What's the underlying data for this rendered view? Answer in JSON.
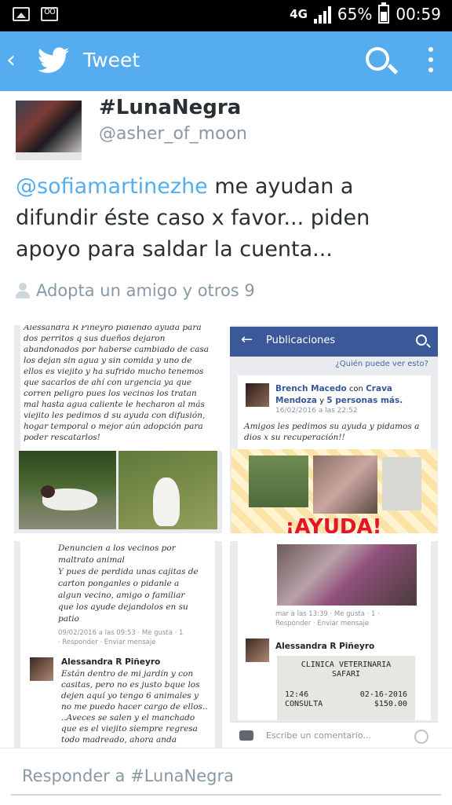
{
  "status_bar": {
    "network": "4G",
    "battery": "65%",
    "time": "00:59",
    "battery_level": 0.65
  },
  "app_bar": {
    "title": "Tweet",
    "back_icon": "chevron-left-icon",
    "logo_icon": "twitter-bird-icon",
    "search_icon": "search-icon",
    "overflow_icon": "more-vert-icon"
  },
  "tweet": {
    "display_name": "#LunaNegra",
    "handle": "@asher_of_moon",
    "mention": "@sofiamartinezhe",
    "text": " me ayudan a difundir éste caso x favor... piden apoyo para saldar la cuenta...",
    "social_context": "Adopta un amigo y otros 9"
  },
  "media": {
    "tile1": {
      "lines": [
        "Alessandra R Piñeyro pidiendo ayuda para",
        "dos perritos q sus dueños dejaron",
        "abandonados por haberse cambiado de casa",
        "los dejan sin agua y sin comida y uno de",
        "ellos es viejito y ha sufrido mucho tenemos",
        "que sacarlos de ahí con urgencia ya que",
        "corren peligro pues los vecinos los tratan",
        "mal hasta agua caliente le hecharon al más",
        "viejito les pedimos d su ayuda con difusión,",
        "hogar temporal o mejor aún adopción para",
        "poder rescatarlos!"
      ]
    },
    "tile2": {
      "header": "Publicaciones",
      "privacy": "¿Quién puede ver esto?",
      "poster": "Brench Macedo",
      "with_text": "con",
      "with_name": "Crava Mendoza",
      "and_text": "y",
      "others": "5 personas más.",
      "date": "16/02/2016 a las 22:52",
      "body": "Amigos les pedimos su ayuda y pidamos a dios x su recuperación!!",
      "banner": "¡AYUDA!"
    },
    "tile3": {
      "lines": [
        "Denuncien a los vecinos por",
        "maltrato animal",
        "Y pues de perdida unas cajitas de",
        "carton ponganles o pidanle a",
        "algun vecino, amigo o familiar",
        "que los ayude dejandolos en su",
        "patio"
      ],
      "meta": "09/02/2016 a las 09:53 · Me gusta · 1",
      "actions": "· Responder · Enviar mensaje",
      "commenter": "Alessandra R Piñeyro",
      "comment_lines": [
        "Están dentro de mi jardín y con",
        "casitas, pero no es justo bque los",
        "dejen aquí yo tengo 6 animales y",
        "no me puedo hacer cargo de ellos..",
        "..Aveces se salen y el manchado",
        "que es el viejito siempre regresa",
        "todo madreado, ahora anda"
      ]
    },
    "tile4": {
      "meta": "mar a las 13:39 · Me gusta · 1 ·",
      "actions": "Responder · Enviar mensaje",
      "commenter": "Alessandra R Piñeyro",
      "receipt_line1": "CLINICA VETERINARIA",
      "receipt_line2": "SAFARI",
      "receipt_time": "12:46",
      "receipt_date": "02-16-2016",
      "receipt_item": "CONSULTA",
      "receipt_amount": "$150.00",
      "comment_placeholder": "Escribe un comentario..."
    }
  },
  "reply": {
    "placeholder": "Responder a #LunaNegra"
  },
  "colors": {
    "twitter_blue": "#55acee",
    "facebook_blue": "#3b5998",
    "text_dark": "#292f33",
    "text_muted": "#8899a6"
  }
}
